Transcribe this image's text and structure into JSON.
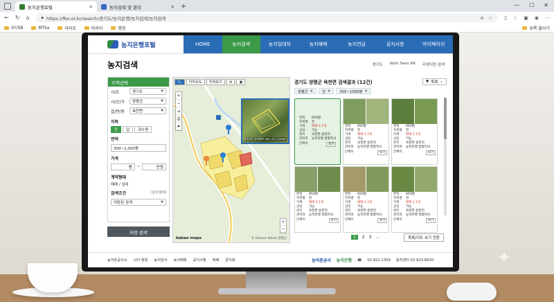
{
  "browser": {
    "tabs": [
      {
        "label": "농지은행포털",
        "close": "✕"
      },
      {
        "label": "농지검색 및 관리",
        "close": "✕"
      }
    ],
    "new_tab": "+",
    "url": "https://fbo.or.kr/search/경기도/농지은행/농지검색/농지검색",
    "bookmarks": [
      "SY/SB",
      "MTka",
      "아리오",
      "마라이",
      "평창"
    ],
    "bookmarks_right": "보록 즐이기"
  },
  "site": {
    "logo": "농지은행포털",
    "nav": [
      "HOME",
      "농지검색",
      "농지임대차",
      "농지매매",
      "농지연금",
      "공지사항",
      "마이페이지"
    ],
    "page_title": "농지검색",
    "utils": [
      "경기도",
      "Noto Sans KR",
      "리셋지린 검색"
    ]
  },
  "filter": {
    "title": "지역선택",
    "rows": [
      {
        "label": "시/도",
        "value": "경기도"
      },
      {
        "label": "시/군/구",
        "value": "양평군"
      },
      {
        "label": "읍/면/동",
        "value": "옥천면"
      }
    ],
    "land_label": "지목",
    "land_chips": [
      "전",
      "답",
      "과수원"
    ],
    "area_label": "면적",
    "area_value": "300~1,000평",
    "price_label": "가격",
    "price_from": "평",
    "price_sep": "~",
    "price_to": "만원",
    "contract_label": "계약형태",
    "contract_value": "매매 / 임대",
    "cond_label": "검색조건",
    "cond_hint": "[검색 항목]",
    "cond_value": "저장된 검색",
    "save_button": "저장 검색"
  },
  "map": {
    "tools": [
      "카카오도",
      "지적보기"
    ],
    "zoom_in": "+",
    "zoom_out": "−",
    "brand": "kakao maps",
    "copyright": "© Kakaoc Kakao 양평군",
    "aerial_caption": "항공사진 입지정보 480, 371,12000"
  },
  "results": {
    "title": "경기도 양평군 옥천면 검색결과 (12건)",
    "sort": "목록",
    "tags": [
      "양평군",
      "전",
      "300~1000평"
    ],
    "cards": [
      {
        "area": "650평",
        "type": "전",
        "price": "매매 2.1억",
        "status": "가능",
        "loc": "옥천면 용천리",
        "owner": "농지은행 양평지사",
        "unit": "단체이",
        "more": "보기"
      },
      {
        "area": "650평",
        "type": "전",
        "price": "매매 2.1억",
        "status": "가능",
        "loc": "옥천면 용천리",
        "owner": "농지은행 양평지사",
        "unit": "단체이",
        "more": "보기"
      },
      {
        "area": "650평",
        "type": "전",
        "price": "매매 2.1억",
        "status": "가능",
        "loc": "옥천면 용천리",
        "owner": "농지은행 양평지사",
        "unit": "단체이",
        "more": "보기"
      },
      {
        "area": "650평",
        "type": "전",
        "price": "매매 2.1억",
        "status": "가능",
        "loc": "옥천면 용천리",
        "owner": "농지은행 양평지사",
        "unit": "단체이",
        "more": "보기"
      },
      {
        "area": "650평",
        "type": "전",
        "price": "매매 2.1억",
        "status": "가능",
        "loc": "옥천면 용천리",
        "owner": "농지은행 양평지사",
        "unit": "단체이",
        "more": "보기"
      },
      {
        "area": "650평",
        "type": "전",
        "price": "매매 2.1억",
        "status": "가능",
        "loc": "옥천면 용천리",
        "owner": "농지은행 양평지사",
        "unit": "단체이",
        "more": "보기"
      }
    ],
    "labels": {
      "area": "면적",
      "type": "지목명",
      "price": "가격",
      "status": "상담",
      "loc": "위치",
      "owner": "관리자",
      "unit": "단체이"
    },
    "pages": [
      "1",
      "2",
      "3",
      "..."
    ],
    "list_button": "목록/지도 보기 전환"
  },
  "footer": {
    "links": [
      "농어촌공사시",
      "시티 정원",
      "농지임서",
      "농지매매",
      "공지사항",
      "택배",
      "문익화"
    ],
    "org1": "농어촌공사",
    "org2": "농지은행",
    "phone1": "02-822-1359",
    "phone2": "동하센터 02-923-8630"
  }
}
